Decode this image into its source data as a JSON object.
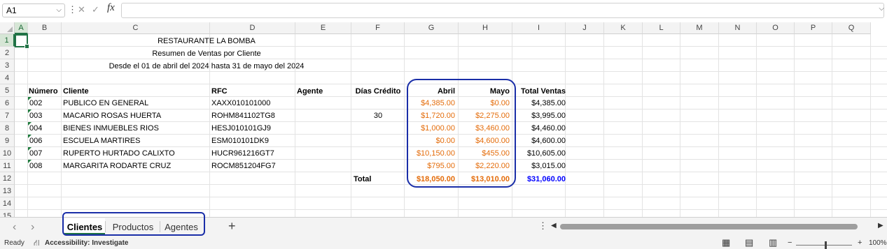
{
  "formula_bar": {
    "name_box": "A1",
    "cancel_glyph": "✕",
    "enter_glyph": "✓",
    "fx_label": "fx",
    "formula_value": ""
  },
  "columns": [
    "A",
    "B",
    "C",
    "D",
    "E",
    "F",
    "G",
    "H",
    "I",
    "J",
    "K",
    "L",
    "M",
    "N",
    "O",
    "P",
    "Q"
  ],
  "rows": [
    "1",
    "2",
    "3",
    "4",
    "5",
    "6",
    "7",
    "8",
    "9",
    "10",
    "11",
    "12",
    "13",
    "14",
    "15"
  ],
  "sheet": {
    "title": "RESTAURANTE LA BOMBA",
    "subtitle": "Resumen de Ventas por Cliente",
    "period": "Desde el 01 de abril del 2024 hasta 31 de mayo del 2024",
    "headers": {
      "numero": "Número",
      "cliente": "Cliente",
      "rfc": "RFC",
      "agente": "Agente",
      "dias_credito": "Días Crédito",
      "abril": "Abril",
      "mayo": "Mayo",
      "total_ventas": "Total Ventas"
    },
    "records": [
      {
        "numero": "002",
        "cliente": "PUBLICO EN GENERAL",
        "rfc": "XAXX010101000",
        "agente": "",
        "dias": "",
        "abril": "$4,385.00",
        "mayo": "$0.00",
        "total": "$4,385.00"
      },
      {
        "numero": "003",
        "cliente": "MACARIO ROSAS HUERTA",
        "rfc": "ROHM841102TG8",
        "agente": "",
        "dias": "30",
        "abril": "$1,720.00",
        "mayo": "$2,275.00",
        "total": "$3,995.00"
      },
      {
        "numero": "004",
        "cliente": "BIENES INMUEBLES RIOS",
        "rfc": "HESJ010101GJ9",
        "agente": "",
        "dias": "",
        "abril": "$1,000.00",
        "mayo": "$3,460.00",
        "total": "$4,460.00"
      },
      {
        "numero": "006",
        "cliente": "ESCUELA MARTIRES",
        "rfc": "ESM010101DK9",
        "agente": "",
        "dias": "",
        "abril": "$0.00",
        "mayo": "$4,600.00",
        "total": "$4,600.00"
      },
      {
        "numero": "007",
        "cliente": "RUPERTO HURTADO CALIXTO",
        "rfc": "HUCR961216GT7",
        "agente": "",
        "dias": "",
        "abril": "$10,150.00",
        "mayo": "$455.00",
        "total": "$10,605.00"
      },
      {
        "numero": "008",
        "cliente": "MARGARITA RODARTE CRUZ",
        "rfc": "ROCM851204FG7",
        "agente": "",
        "dias": "",
        "abril": "$795.00",
        "mayo": "$2,220.00",
        "total": "$3,015.00"
      }
    ],
    "totals": {
      "label": "Total",
      "abril": "$18,050.00",
      "mayo": "$13,010.00",
      "total": "$31,060.00"
    }
  },
  "sheet_tabs": [
    "Clientes",
    "Productos",
    "Agentes"
  ],
  "active_tab": "Clientes",
  "tab_bar": {
    "prev": "‹",
    "next": "›",
    "add": "+",
    "more": "⋮"
  },
  "status_bar": {
    "ready": "Ready",
    "accessibility": "Accessibility: Investigate",
    "zoom": "100%",
    "zoom_minus": "−",
    "zoom_plus": "+"
  },
  "colors": {
    "accent": "#217346",
    "highlight": "#1a2ea8",
    "month_values": "#e46c0a",
    "grand_total": "#0000ff"
  }
}
